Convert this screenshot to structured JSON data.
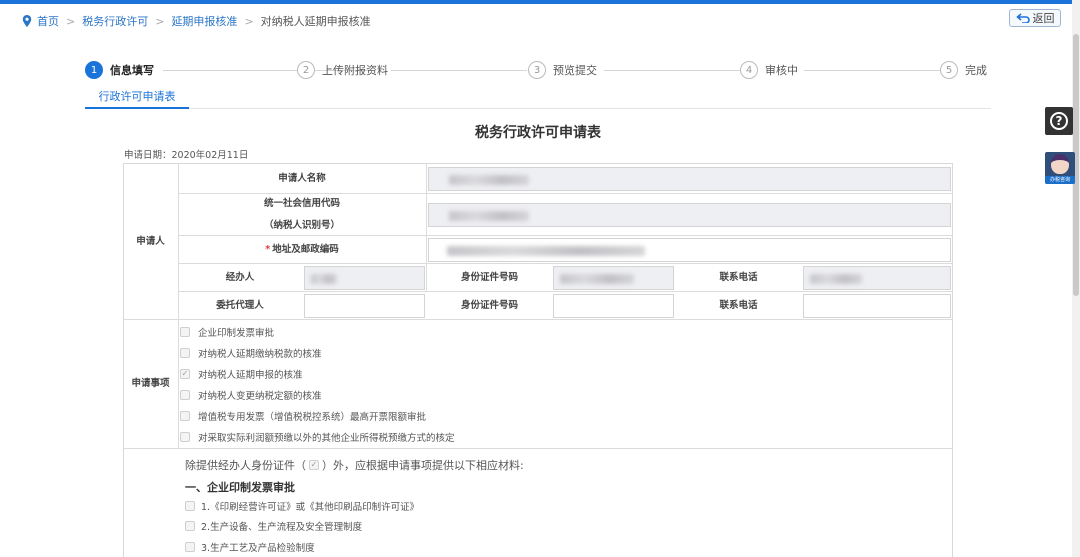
{
  "breadcrumb": {
    "home": "首页",
    "level1": "税务行政许可",
    "level2": "延期申报核准",
    "current": "对纳税人延期申报核准"
  },
  "back_label": "返回",
  "float": {
    "help_glyph": "?",
    "agent_label": "办税咨询"
  },
  "steps": [
    {
      "num": "1",
      "label": "信息填写"
    },
    {
      "num": "2",
      "label": "上传附报资料"
    },
    {
      "num": "3",
      "label": "预览提交"
    },
    {
      "num": "4",
      "label": "审核中"
    },
    {
      "num": "5",
      "label": "完成"
    }
  ],
  "tab_label": "行政许可申请表",
  "form": {
    "title": "税务行政许可申请表",
    "date": "申请日期：2020年02月11日",
    "applicant_section": "申请人",
    "applicant_name_label": "申请人名称",
    "credit_code_label_1": "统一社会信用代码",
    "credit_code_label_2": "（纳税人识别号）",
    "address_label": "地址及邮政编码",
    "required_mark": "*",
    "handler_label": "经办人",
    "id_number_label": "身份证件号码",
    "phone_label": "联系电话",
    "agent_label": "委托代理人",
    "agent_id_label": "身份证件号码",
    "agent_phone_label": "联系电话"
  },
  "matters": {
    "section_label": "申请事项",
    "items": [
      {
        "label": "企业印制发票审批",
        "checked": false
      },
      {
        "label": "对纳税人延期缴纳税款的核准",
        "checked": false
      },
      {
        "label": "对纳税人延期申报的核准",
        "checked": true
      },
      {
        "label": "对纳税人变更纳税定额的核准",
        "checked": false
      },
      {
        "label": "增值税专用发票（增值税税控系统）最高开票限额审批",
        "checked": false
      },
      {
        "label": "对采取实际利润额预缴以外的其他企业所得税预缴方式的核定",
        "checked": false
      }
    ]
  },
  "materials": {
    "intro_before": "除提供经办人身份证件（",
    "intro_after": "）外，应根据申请事项提供以下相应材料:",
    "section_title": "一、企业印制发票审批",
    "items": [
      "1.《印刷经营许可证》或《其他印刷品印制许可证》",
      "2.生产设备、生产流程及安全管理制度",
      "3.生产工艺及产品检验制度"
    ]
  },
  "colors": {
    "accent": "#1a73d9",
    "required": "#e03b3b"
  }
}
